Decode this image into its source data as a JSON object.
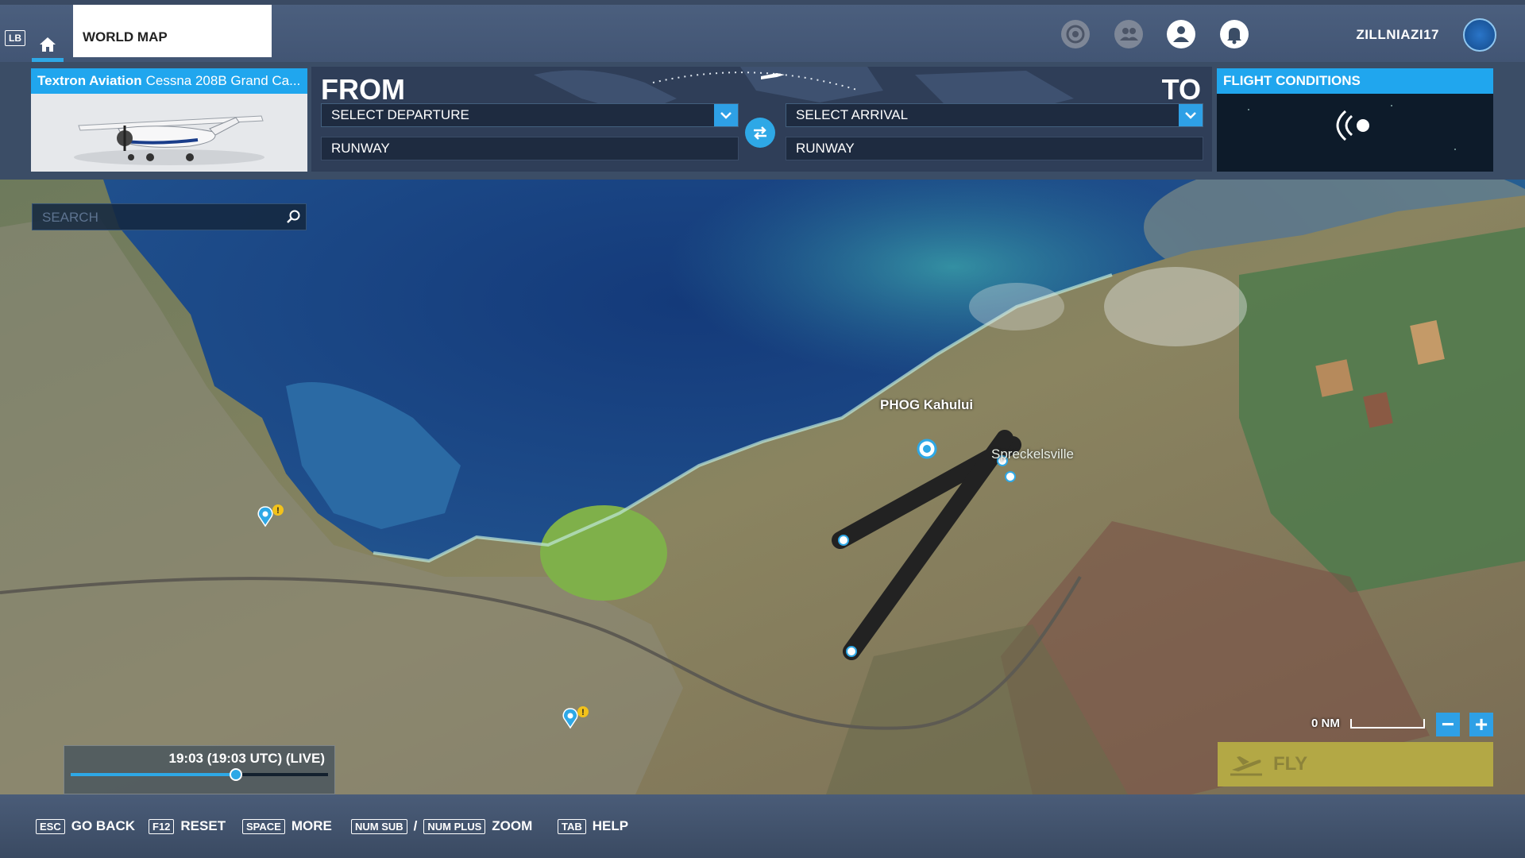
{
  "topbar": {
    "lb_key": "LB",
    "home_icon": "home-icon",
    "tab_label": "WORLD MAP",
    "icons": [
      "achievements-icon",
      "friends-icon",
      "profile-icon",
      "notifications-icon"
    ],
    "username": "ZILLNIAZI17",
    "accent_color": "#2ea8e6"
  },
  "aircraft": {
    "brand": "Textron Aviation",
    "model": "Cessna 208B Grand Ca..."
  },
  "route": {
    "from_label": "FROM",
    "to_label": "TO",
    "departure_value": "SELECT DEPARTURE",
    "arrival_value": "SELECT ARRIVAL",
    "departure_runway": "RUNWAY",
    "arrival_runway": "RUNWAY",
    "swap_icon": "swap-icon"
  },
  "conditions": {
    "title": "FLIGHT CONDITIONS",
    "icon": "live-weather-icon"
  },
  "map": {
    "search_placeholder": "SEARCH",
    "airport_label": "PHOG Kahului",
    "town_label": "Spreckelsville",
    "time_text": "19:03 (19:03 UTC) (LIVE)",
    "time_progress_fraction": 0.64,
    "scale_label": "0 NM",
    "zoom_out_label": "−",
    "zoom_in_label": "+",
    "fly_label": "FLY",
    "fly_color": "#b3a845"
  },
  "hints": [
    {
      "key": "ESC",
      "label": "GO BACK"
    },
    {
      "key": "F12",
      "label": "RESET"
    },
    {
      "key": "SPACE",
      "label": "MORE"
    },
    {
      "key": "NUM SUB",
      "label": ""
    },
    {
      "key": "NUM PLUS",
      "label": "ZOOM"
    },
    {
      "key": "TAB",
      "label": "HELP"
    }
  ],
  "hint_separator": "/"
}
